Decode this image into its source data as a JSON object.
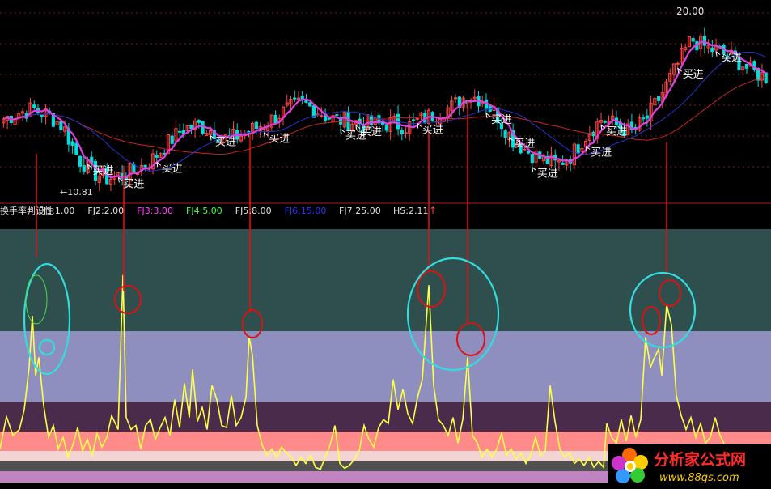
{
  "chart_data": [
    {
      "type": "candlestick",
      "title": "",
      "annotations": {
        "high_label": "20.00",
        "low_label": "←10.81",
        "signal_text": "买进"
      },
      "price_range": [
        10.81,
        20.0
      ],
      "ma_colors": {
        "short": "#e040e0",
        "mid": "#2233cc",
        "long": "#cc2222"
      },
      "up_color": "#ff4444",
      "down_color": "#00dddd",
      "approx_close": [
        14.6,
        14.9,
        15.1,
        14.8,
        14.2,
        12.6,
        11.9,
        11.6,
        11.8,
        12.1,
        12.6,
        13.4,
        14.1,
        14.3,
        14.0,
        13.6,
        13.8,
        14.2,
        14.6,
        15.1,
        15.4,
        15.0,
        14.6,
        14.5,
        14.4,
        14.3,
        14.4,
        14.2,
        14.6,
        14.9,
        15.2,
        15.8,
        15.6,
        14.8,
        13.6,
        13.0,
        12.6,
        12.3,
        12.8,
        13.8,
        14.6,
        14.3,
        13.9,
        14.6,
        15.8,
        17.2,
        18.6,
        18.2,
        17.9,
        17.6,
        17.0,
        16.7
      ]
    },
    {
      "type": "line",
      "indicator_label": "换手率判设性",
      "levels": [
        {
          "name": "FJ1",
          "value_text": "1.00",
          "color": "#e0e0e0"
        },
        {
          "name": "FJ2",
          "value_text": "2.00",
          "color": "#e0e0e0"
        },
        {
          "name": "FJ3",
          "value_text": "3.00",
          "color": "#ff44ff"
        },
        {
          "name": "FJ4",
          "value_text": "5.00",
          "color": "#44ff44"
        },
        {
          "name": "FJ5",
          "value_text": "8.00",
          "color": "#e0e0e0"
        },
        {
          "name": "FJ6",
          "value_text": "15.00",
          "color": "#2233ff"
        },
        {
          "name": "FJ7",
          "value_text": "25.00",
          "color": "#e0e0e0"
        }
      ],
      "current": {
        "name": "HS",
        "value_text": "2.11",
        "arrow": "↑"
      },
      "bands": [
        {
          "from": 15,
          "to": 25,
          "color": "#2f4f4f"
        },
        {
          "from": 8,
          "to": 15,
          "color": "#8e8ebf"
        },
        {
          "from": 5,
          "to": 8,
          "color": "#4b2b4b"
        },
        {
          "from": 3,
          "to": 5,
          "color": "#ff8a8a"
        },
        {
          "from": 2,
          "to": 3,
          "color": "#f2d4d4"
        },
        {
          "from": 1,
          "to": 2,
          "color": "#505050"
        },
        {
          "from": 0,
          "to": 1,
          "color": "#c084c0"
        }
      ],
      "series_color": "#ffff44"
    }
  ],
  "watermark": {
    "title": "分析家公式网",
    "url": "www.88gs.com"
  }
}
